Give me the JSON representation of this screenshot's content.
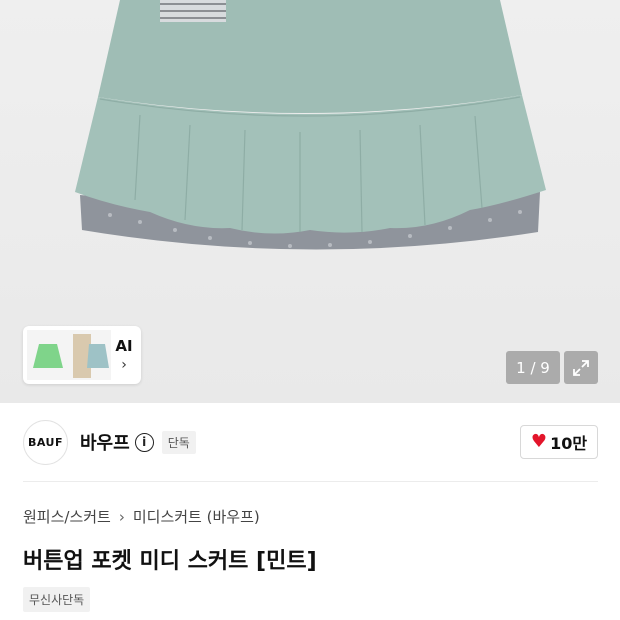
{
  "gallery": {
    "counter": "1 / 9",
    "ai_label": "AI",
    "ai_chevron": "›",
    "expand_icon": "expand-icon"
  },
  "brand": {
    "logo_text": "BAUF",
    "name": "바우프",
    "info_symbol": "i",
    "exclusive_badge": "단독",
    "likes": "10만",
    "heart_color": "#e3152b"
  },
  "breadcrumb": {
    "category": "원피스/스커트",
    "separator": "›",
    "subcategory": "미디스커트 (바우프)"
  },
  "product": {
    "title": "버튼업 포켓 미디 스커트 [민트]",
    "tag": "무신사단독"
  },
  "colors": {
    "skirt_mint": "#9ebcb4",
    "lining_floral": "#8f949c"
  }
}
